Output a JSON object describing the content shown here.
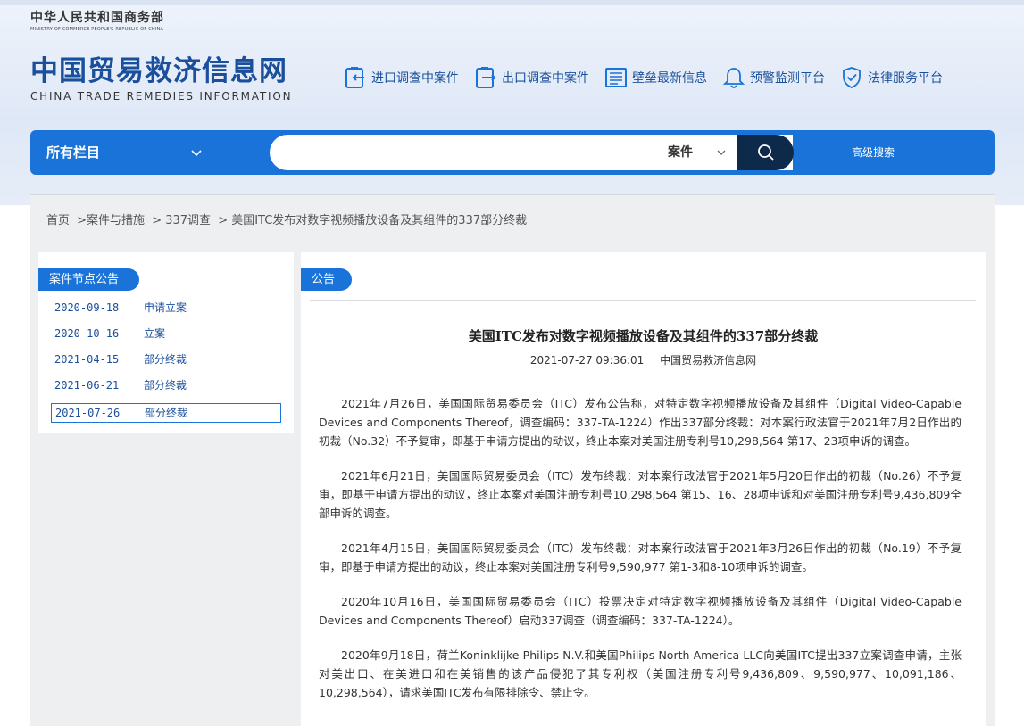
{
  "ministry": {
    "cn": "中华人民共和国商务部",
    "en": "MINISTRY OF COMMERCE PEOPLE'S REPUBLIC OF CHINA"
  },
  "logo": {
    "cn": "中国贸易救济信息网",
    "en": "CHINA TRADE REMEDIES INFORMATION"
  },
  "topnav": [
    {
      "label": "进口调查中案件",
      "icon": "import-case-icon"
    },
    {
      "label": "出口调查中案件",
      "icon": "export-case-icon"
    },
    {
      "label": "壁垒最新信息",
      "icon": "barrier-info-icon"
    },
    {
      "label": "预警监测平台",
      "icon": "bell-icon"
    },
    {
      "label": "法律服务平台",
      "icon": "shield-icon"
    }
  ],
  "search": {
    "all_columns": "所有栏目",
    "category": "案件",
    "value": "",
    "advanced": "高级搜索"
  },
  "breadcrumb": {
    "home": "首页",
    "level1": ">案件与措施",
    "level2": "> 337调查",
    "current": "> 美国ITC发布对数字视频播放设备及其组件的337部分终裁"
  },
  "left_panel": {
    "title": "案件节点公告",
    "items": [
      {
        "date": "2020-09-18",
        "type": "申请立案"
      },
      {
        "date": "2020-10-16",
        "type": "立案"
      },
      {
        "date": "2021-04-15",
        "type": "部分终裁"
      },
      {
        "date": "2021-06-21",
        "type": "部分终裁"
      },
      {
        "date": "2021-07-26",
        "type": "部分终裁"
      }
    ]
  },
  "right_panel": {
    "title": "公告"
  },
  "article": {
    "title": "美国ITC发布对数字视频播放设备及其组件的337部分终裁",
    "datetime": "2021-07-27 09:36:01",
    "source": "中国贸易救济信息网",
    "paragraphs": [
      "2021年7月26日，美国国际贸易委员会（ITC）发布公告称，对特定数字视频播放设备及其组件（Digital Video-Capable Devices and Components Thereof，调查编码：337-TA-1224）作出337部分终裁：对本案行政法官于2021年7月2日作出的初裁（No.32）不予复审，即基于申请方提出的动议，终止本案对美国注册专利号10,298,564 第17、23项申诉的调查。",
      "2021年6月21日，美国国际贸易委员会（ITC）发布终裁：对本案行政法官于2021年5月20日作出的初裁（No.26）不予复审，即基于申请方提出的动议，终止本案对美国注册专利号10,298,564 第15、16、28项申诉和对美国注册专利号9,436,809全部申诉的调查。",
      "2021年4月15日，美国国际贸易委员会（ITC）发布终裁：对本案行政法官于2021年3月26日作出的初裁（No.19）不予复审，即基于申请方提出的动议，终止本案对美国注册专利号9,590,977 第1-3和8-10项申诉的调查。",
      "2020年10月16日，美国国际贸易委员会（ITC）投票决定对特定数字视频播放设备及其组件（Digital Video-Capable Devices and Components Thereof）启动337调查（调查编码：337-TA-1224）。",
      "2020年9月18日，荷兰Koninklijke Philips N.V.和美国Philips North America LLC向美国ITC提出337立案调查申请，主张对美出口、在美进口和在美销售的该产品侵犯了其专利权（美国注册专利号9,436,809、9,590,977、10,091,186、10,298,564），请求美国ITC发布有限排除令、禁止令。"
    ]
  }
}
